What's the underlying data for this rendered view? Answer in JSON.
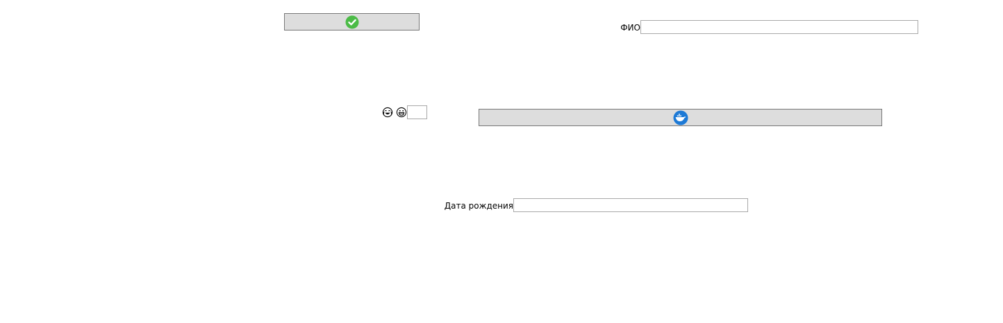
{
  "form": {
    "fio_label": "ФИО",
    "fio_value": "",
    "dob_label": "Дата рождения",
    "dob_value": "",
    "small_value": ""
  },
  "icons": {
    "ok_button_icon": "checkmark-circle-icon",
    "docker_button_icon": "docker-whale-icon",
    "emoji_1": "tears-of-joy-emoji-icon",
    "emoji_2": "grinning-face-emoji-icon"
  },
  "colors": {
    "button_bg": "#dddddd",
    "check_green": "#4cbb47",
    "docker_blue": "#1d7ad6"
  }
}
